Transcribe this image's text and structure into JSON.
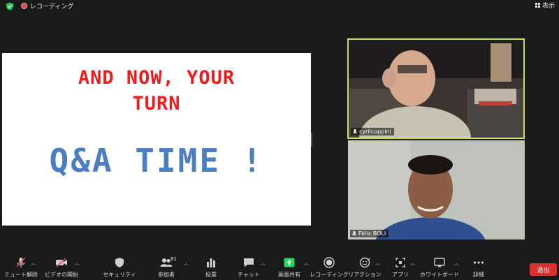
{
  "top_bar": {
    "security_icon": "shield-check-icon",
    "recording_label": "レコーディング",
    "view_label": "表示"
  },
  "shared_screen": {
    "line1": "AND NOW, YOUR",
    "line2": "TURN",
    "line3": "Q&A TIME !"
  },
  "participants": [
    {
      "name": "cyrilcoppini",
      "active_speaker": true
    },
    {
      "name": "Félix BOLI",
      "active_speaker": false
    }
  ],
  "toolbar": {
    "mute_label": "ミュート解除",
    "video_label": "ビデオの開始",
    "security_label": "セキュリティ",
    "participants_label": "参加者",
    "participants_count": "81",
    "polls_label": "投票",
    "chat_label": "チャット",
    "share_label": "画面共有",
    "record_label": "レコーディング",
    "reactions_label": "リアクション",
    "apps_label": "アプリ",
    "whiteboard_label": "ホワイトボード",
    "more_label": "詳細",
    "leave_label": "退出"
  },
  "colors": {
    "background": "#1a1a1a",
    "slide_red": "#ee1c1c",
    "slide_blue": "#4a7ec0",
    "active_speaker_border": "#c5e35a",
    "share_green": "#23d959",
    "leave_red": "#d9302e"
  }
}
